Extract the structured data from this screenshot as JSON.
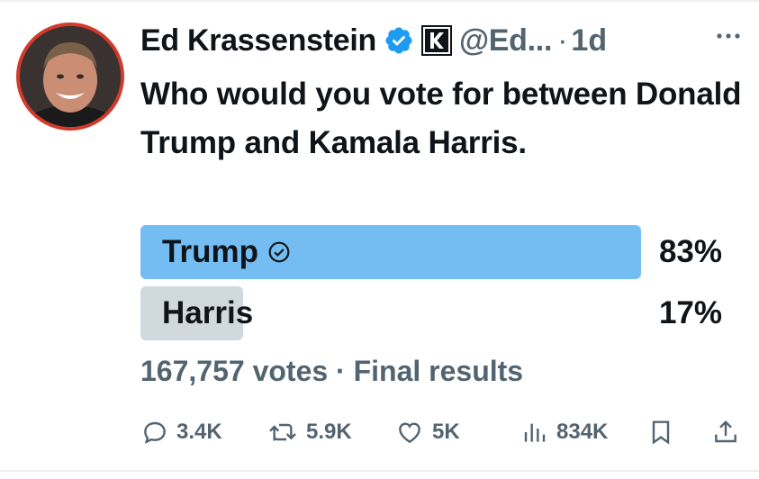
{
  "tweet": {
    "author_name": "Ed Krassenstein",
    "handle": "@Ed...",
    "separator": "·",
    "time": "1d",
    "text": "Who would you vote for between Donald Trump and Kamala Harris.",
    "colors": {
      "accent": "#1d9bf0",
      "winner_fill": "#74bdf3",
      "loser_fill": "#cfd9de",
      "secondary_text": "#536471",
      "avatar_ring": "#d23a2b"
    }
  },
  "poll": {
    "options": [
      {
        "label": "Trump",
        "percent": "83%",
        "share": 0.83,
        "winner": true
      },
      {
        "label": "Harris",
        "percent": "17%",
        "share": 0.17,
        "winner": false
      }
    ],
    "votes": "167,757 votes",
    "separator": "·",
    "status": "Final results"
  },
  "actions": {
    "replies": "3.4K",
    "reposts": "5.9K",
    "likes": "5K",
    "views": "834K",
    "icons": [
      "reply-icon",
      "repost-icon",
      "like-icon",
      "views-icon",
      "bookmark-icon",
      "share-icon"
    ]
  }
}
